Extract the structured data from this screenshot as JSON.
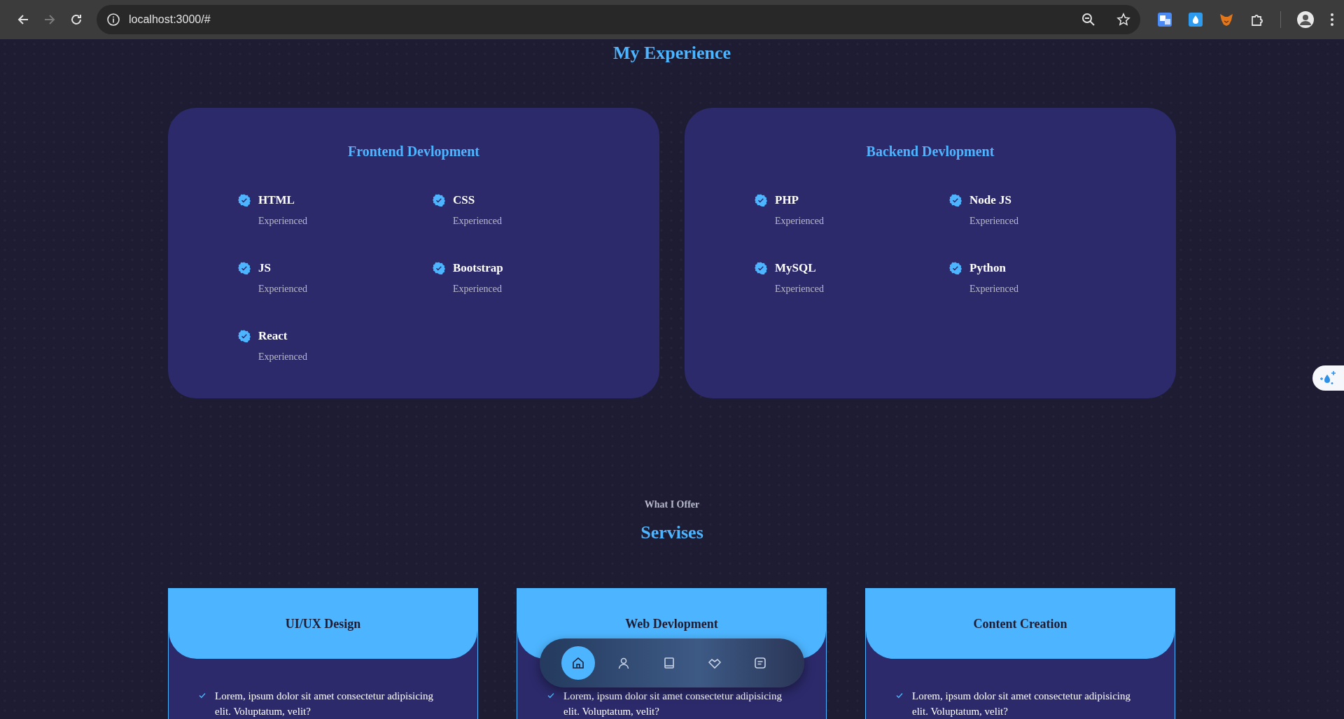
{
  "browser": {
    "url": "localhost:3000/#",
    "forward_disabled": true
  },
  "experience": {
    "title": "My Experience",
    "cards": [
      {
        "title": "Frontend Devlopment",
        "skills": [
          {
            "name": "HTML",
            "note": "Experienced"
          },
          {
            "name": "CSS",
            "note": "Experienced"
          },
          {
            "name": "JS",
            "note": "Experienced"
          },
          {
            "name": "Bootstrap",
            "note": "Experienced"
          },
          {
            "name": "React",
            "note": "Experienced"
          }
        ]
      },
      {
        "title": "Backend Devlopment",
        "skills": [
          {
            "name": "PHP",
            "note": "Experienced"
          },
          {
            "name": "Node JS",
            "note": "Experienced"
          },
          {
            "name": "MySQL",
            "note": "Experienced"
          },
          {
            "name": "Python",
            "note": "Experienced"
          }
        ]
      }
    ]
  },
  "services": {
    "subtitle": "What I Offer",
    "title": "Servises",
    "cards": [
      {
        "title": "UI/UX Design",
        "points": [
          "Lorem, ipsum dolor sit amet consectetur adipisicing elit. Voluptatum, velit?"
        ]
      },
      {
        "title": "Web Devlopment",
        "points": [
          "Lorem, ipsum dolor sit amet consectetur adipisicing elit. Voluptatum, velit?"
        ]
      },
      {
        "title": "Content Creation",
        "points": [
          "Lorem, ipsum dolor sit amet consectetur adipisicing elit. Voluptatum, velit?"
        ]
      }
    ]
  },
  "bottom_nav": {
    "items": [
      {
        "selected": true
      },
      {
        "selected": false
      },
      {
        "selected": false
      },
      {
        "selected": false
      },
      {
        "selected": false
      }
    ]
  }
}
